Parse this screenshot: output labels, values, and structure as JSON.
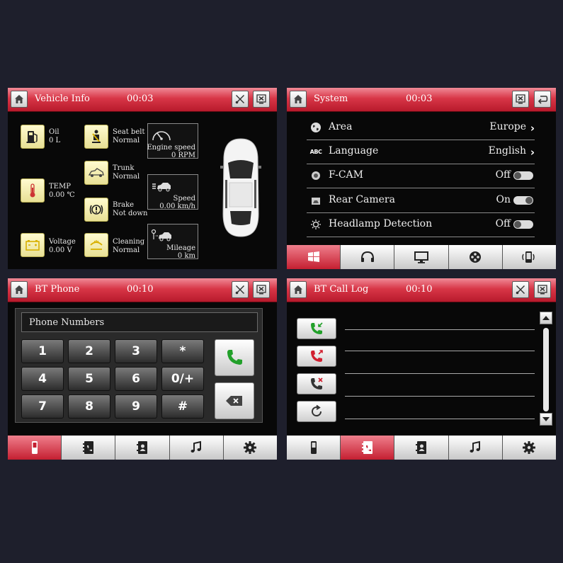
{
  "vehicle_info": {
    "title": "Vehicle Info",
    "time": "00:03",
    "items": [
      {
        "label": "Oil",
        "value": "0 L",
        "icon": "fuel-pump-icon"
      },
      {
        "label": "TEMP",
        "value": "0.00 ℃",
        "icon": "thermometer-icon"
      },
      {
        "label": "Voltage",
        "value": "0.00 V",
        "icon": "battery-icon"
      },
      {
        "label": "Seat belt",
        "value": "Normal",
        "icon": "seat-belt-icon"
      },
      {
        "label": "Trunk",
        "value": "Normal",
        "icon": "trunk-icon"
      },
      {
        "label": "Brake",
        "value": "Not down",
        "icon": "brake-icon"
      },
      {
        "label": "Cleaning",
        "value": "Normal",
        "icon": "washer-icon"
      }
    ],
    "gauges": [
      {
        "label": "Engine speed",
        "value": "0 RPM",
        "icon": "tachometer-icon"
      },
      {
        "label": "Speed",
        "value": "0.00 km/h",
        "icon": "speed-car-icon"
      },
      {
        "label": "Mileage",
        "value": "0 km",
        "icon": "mileage-car-icon"
      }
    ]
  },
  "system": {
    "title": "System",
    "time": "00:03",
    "rows": [
      {
        "label": "Area",
        "value": "Europe",
        "control": "arrow",
        "icon": "globe-icon"
      },
      {
        "label": "Language",
        "value": "English",
        "control": "arrow",
        "icon": "abc-icon",
        "icon_text": "ABC"
      },
      {
        "label": "F-CAM",
        "value": "Off",
        "control": "toggle",
        "state": "off",
        "icon": "camera-icon"
      },
      {
        "label": "Rear Camera",
        "value": "On",
        "control": "toggle",
        "state": "on",
        "icon": "rear-camera-icon"
      },
      {
        "label": "Headlamp Detection",
        "value": "Off",
        "control": "toggle",
        "state": "off",
        "icon": "headlamp-icon"
      }
    ],
    "tabs": [
      "windows-icon",
      "headphones-icon",
      "monitor-icon",
      "film-reel-icon",
      "phone-vibrate-icon"
    ],
    "active_tab": 0
  },
  "bt_phone": {
    "title": "BT Phone",
    "time": "00:10",
    "placeholder": "Phone Numbers",
    "keys": [
      "1",
      "2",
      "3",
      "*",
      "4",
      "5",
      "6",
      "0/+",
      "7",
      "8",
      "9",
      "#"
    ],
    "tabs": [
      "mobile-phone-icon",
      "phonebook-icon",
      "contacts-icon",
      "music-note-icon",
      "settings-gear-icon"
    ],
    "active_tab": 0
  },
  "bt_call_log": {
    "title": "BT Call Log",
    "time": "00:10",
    "buttons": [
      "incoming-call-icon",
      "outgoing-call-icon",
      "missed-call-icon",
      "refresh-icon"
    ],
    "tabs": [
      "mobile-phone-icon",
      "call-log-icon",
      "contacts-icon",
      "music-note-icon",
      "settings-gear-icon"
    ],
    "active_tab": 1
  },
  "colors": {
    "header_red": "#d83647",
    "panel_bg": "#080808",
    "page_bg": "#1e1f2c",
    "icon_yellow": "#f5eeae",
    "call_green": "#22a02a",
    "call_red": "#d11f2f"
  }
}
